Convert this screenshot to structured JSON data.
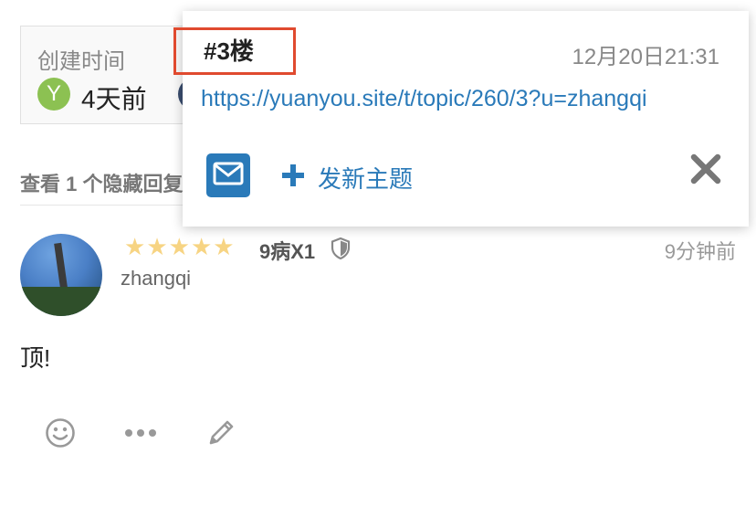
{
  "meta": {
    "created_label": "创建时间",
    "created_avatar_letter": "Y",
    "created_value": "4天前"
  },
  "hidden_replies": {
    "text": "查看 1 个隐藏回复"
  },
  "post": {
    "stars": 5,
    "badge_text": "9病X1",
    "time_ago": "9分钟前",
    "username": "zhangqi",
    "body": "顶!",
    "actions": [
      "smile-icon",
      "more-icon",
      "edit-icon"
    ]
  },
  "share_popup": {
    "floor": "#3楼",
    "date": "12月20日21:31",
    "link": "https://yuanyou.site/t/topic/260/3?u=zhangqi",
    "new_topic_label": "发新主题",
    "colors": {
      "accent": "#2a7ab9",
      "highlight": "#e04a2f"
    }
  }
}
